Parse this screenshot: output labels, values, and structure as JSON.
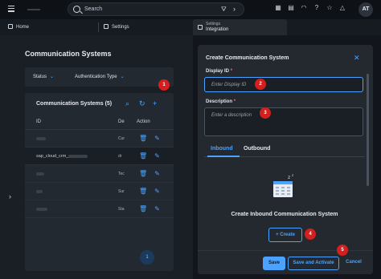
{
  "topbar": {
    "search_placeholder": "Search",
    "filter_glyph": "⛛",
    "chevron_glyph": "›",
    "icons": [
      "app-finder-icon",
      "notes-icon",
      "headset-icon",
      "help-icon",
      "favorite-icon",
      "notifications-icon"
    ],
    "avatar_initials": "AT"
  },
  "tabs": {
    "home": "Home",
    "settings": "Settings",
    "integration_sub": "Settings",
    "integration": "Integration"
  },
  "left": {
    "title": "Communication Systems",
    "filters": [
      "Status",
      "Authentication Type"
    ],
    "table_title": "Communication Systems (5)",
    "headers": {
      "id": "ID",
      "de": "De",
      "action": "Action"
    },
    "rows": [
      {
        "id": "",
        "de": "Cur"
      },
      {
        "id": "sap_cloud_crm_",
        "de": "dr"
      },
      {
        "id": "",
        "de": "Tec"
      },
      {
        "id": "",
        "de": "Sur"
      },
      {
        "id": "",
        "de": "Sta"
      }
    ],
    "page": "1"
  },
  "dialog": {
    "title": "Create Communication System",
    "display_id_label": "Display ID",
    "required_mark": "*",
    "display_id_placeholder": "Enter Display ID",
    "description_label": "Description",
    "description_placeholder": "Enter a description",
    "tab_inbound": "Inbound",
    "tab_outbound": "Outbound",
    "empty_title": "Create Inbound Communication System",
    "create_label": "+ Create",
    "save": "Save",
    "save_activate": "Save and Activate",
    "cancel": "Cancel"
  },
  "markers": [
    "1",
    "2",
    "3",
    "4",
    "5"
  ],
  "colors": {
    "accent": "#4ba3ff",
    "marker": "#d41f1f",
    "background": "#12161c",
    "panel": "#23292f"
  }
}
